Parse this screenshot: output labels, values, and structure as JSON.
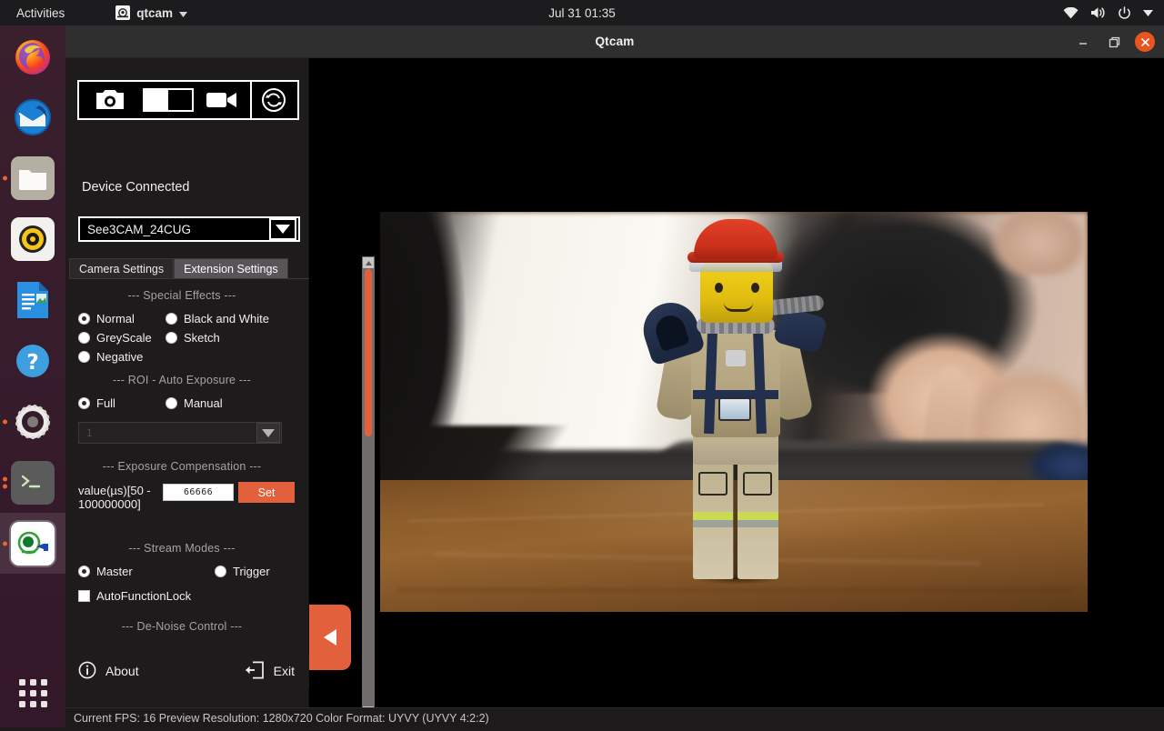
{
  "topbar": {
    "activities": "Activities",
    "app_name": "qtcam",
    "app_icon": "qtcam-icon",
    "menu_arrow_icon": "chevron-down-icon",
    "clock": "Jul 31  01:35",
    "indicators": [
      "wifi-icon",
      "volume-icon",
      "power-icon",
      "chevron-down-icon"
    ]
  },
  "dock": {
    "items": [
      {
        "name": "firefox",
        "label": "Firefox",
        "running": false,
        "active": false
      },
      {
        "name": "thunderbird",
        "label": "Thunderbird",
        "running": false,
        "active": false
      },
      {
        "name": "files",
        "label": "Files",
        "running": true,
        "active": false
      },
      {
        "name": "rhythmbox",
        "label": "Rhythmbox",
        "running": false,
        "active": false
      },
      {
        "name": "libreoffice-writer",
        "label": "LibreOffice Writer",
        "running": false,
        "active": false
      },
      {
        "name": "help",
        "label": "Help",
        "running": false,
        "active": false
      },
      {
        "name": "settings",
        "label": "Settings",
        "running": true,
        "active": false
      },
      {
        "name": "terminal",
        "label": "Terminal",
        "running": true,
        "active": false
      },
      {
        "name": "qtcam",
        "label": "Qtcam",
        "running": true,
        "active": true
      }
    ],
    "show_apps_label": "Show Applications"
  },
  "window": {
    "title": "Qtcam",
    "minimize_icon": "minimize-icon",
    "maximize_icon": "maximize-icon",
    "close_icon": "close-icon",
    "accent": "#e95420"
  },
  "panel": {
    "capture_bar": {
      "still_capture_icon": "camera-icon",
      "mode_toggle_label": "still-video-toggle",
      "mode_toggle_state": "still",
      "video_capture_icon": "video-camera-icon",
      "refresh_icon": "refresh-icon"
    },
    "device_status": "Device Connected",
    "device_select": {
      "value": "See3CAM_24CUG",
      "arrow_icon": "triangle-down-icon"
    },
    "tabs": [
      {
        "id": "camera-settings",
        "label": "Camera Settings",
        "active": false
      },
      {
        "id": "extension-settings",
        "label": "Extension Settings",
        "active": true
      }
    ],
    "sections": {
      "special_effects": {
        "heading": "--- Special Effects ---",
        "options": [
          {
            "label": "Normal",
            "selected": true
          },
          {
            "label": "Black and White",
            "selected": false
          },
          {
            "label": "GreyScale",
            "selected": false
          },
          {
            "label": "Sketch",
            "selected": false
          },
          {
            "label": "Negative",
            "selected": false
          }
        ]
      },
      "roi_auto_exposure": {
        "heading": "--- ROI - Auto Exposure ---",
        "options": [
          {
            "label": "Full",
            "selected": true
          },
          {
            "label": "Manual",
            "selected": false
          }
        ],
        "window_size_value": "1",
        "window_size_arrow_icon": "triangle-down-icon",
        "window_size_enabled": false
      },
      "exposure_compensation": {
        "heading": "--- Exposure Compensation ---",
        "field_label": "value(µs)[50 - 100000000]",
        "value": "66666",
        "set_button_label": "Set",
        "set_button_color": "#e2603c"
      },
      "stream_modes": {
        "heading": "--- Stream Modes ---",
        "options": [
          {
            "label": "Master",
            "selected": true
          },
          {
            "label": "Trigger",
            "selected": false
          }
        ],
        "checkbox": {
          "label": "AutoFunctionLock",
          "checked": false
        }
      },
      "de_noise_control": {
        "heading": "--- De-Noise Control ---"
      }
    },
    "scrollbar": {
      "up_arrow_icon": "scroll-up-icon",
      "down_arrow_icon": "scroll-down-icon",
      "thumb_color": "#e2603c"
    },
    "footer": {
      "about_icon": "info-icon",
      "about_label": "About",
      "exit_icon": "exit-icon",
      "exit_label": "Exit"
    },
    "collapse_button": {
      "icon": "triangle-left-icon",
      "color": "#e2603c"
    }
  },
  "statusbar": {
    "text": "Current FPS: 16 Preview Resolution: 1280x720  Color Format: UYVY (UYVY 4:2:2)"
  },
  "preview": {
    "name": "camera-preview",
    "description": "Live camera preview of a LEGO firefighter minifigure on a wooden desk, with a blurred person, keyboard and mouse in the background"
  }
}
